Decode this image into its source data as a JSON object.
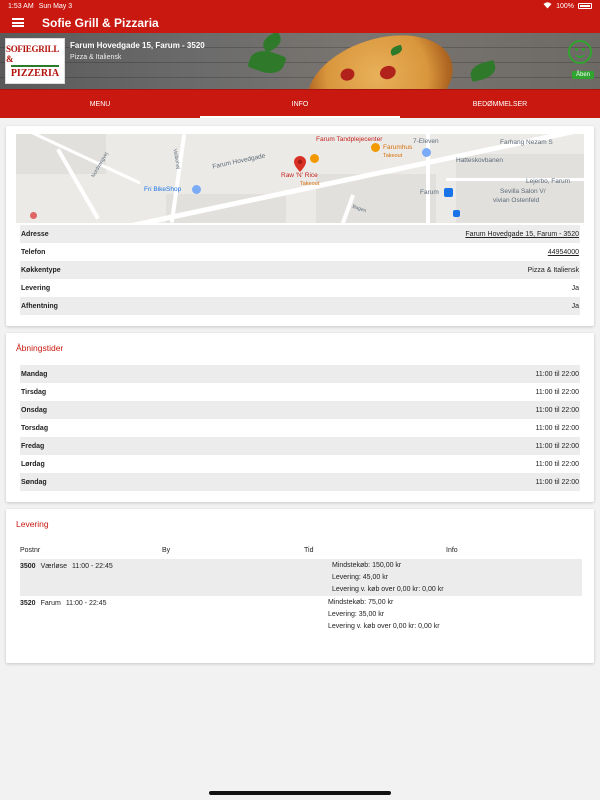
{
  "status_bar": {
    "time": "1:53 AM",
    "date": "Sun May 3",
    "battery": "100%"
  },
  "app_bar": {
    "title": "Sofie Grill & Pizzaria"
  },
  "hero": {
    "logo_line1": "SOFIEGRILL &",
    "logo_line2": "PIZZERIA",
    "address": "Farum Hovedgade 15, Farum - 3520",
    "cuisine": "Pizza & Italiensk",
    "status_badge": "Åben"
  },
  "tabs": [
    {
      "label": "MENU"
    },
    {
      "label": "INFO",
      "active": true
    },
    {
      "label": "BEDØMMELSER"
    }
  ],
  "map": {
    "labels": {
      "tandpleje": "Farum Tandplejecenter",
      "farumhus": "Farumhus",
      "farumhus_sub": "Takeout",
      "raw": "Raw 'N' Rice",
      "raw_sub": "Takeout",
      "eleven": "7-Eleven",
      "farhang": "Farhang Nezam S",
      "hovedgade": "Farum Hovedgade",
      "bikeshop": "Fri BikeShop",
      "hatesko": "Hatteskovbanen",
      "lejerbo": "Lejerbo, Farum",
      "farum": "Farum",
      "sevilla1": "Sevilla Salon V/",
      "sevilla2": "vivian Ostenfeld",
      "nordvej": "Nordvangvej",
      "valby": "Vallbohøj",
      "bagen": "Bagen"
    }
  },
  "info": {
    "rows": [
      {
        "key": "Adresse",
        "value": "Farum Hovedgade 15, Farum - 3520",
        "link": true
      },
      {
        "key": "Telefon",
        "value": "44954000",
        "link": true
      },
      {
        "key": "Køkkentype",
        "value": "Pizza & Italiensk",
        "link": false
      },
      {
        "key": "Levering",
        "value": "Ja",
        "link": false
      },
      {
        "key": "Afhentning",
        "value": "Ja",
        "link": false
      }
    ]
  },
  "hours": {
    "title": "Åbningstider",
    "rows": [
      {
        "day": "Mandag",
        "time": "11:00 til 22:00"
      },
      {
        "day": "Tirsdag",
        "time": "11:00 til 22:00"
      },
      {
        "day": "Onsdag",
        "time": "11:00 til 22:00"
      },
      {
        "day": "Torsdag",
        "time": "11:00 til 22:00"
      },
      {
        "day": "Fredag",
        "time": "11:00 til 22:00"
      },
      {
        "day": "Lørdag",
        "time": "11:00 til 22:00"
      },
      {
        "day": "Søndag",
        "time": "11:00 til 22:00"
      }
    ]
  },
  "delivery": {
    "title": "Levering",
    "columns": [
      "Postnr",
      "By",
      "Tid",
      "Info"
    ],
    "rows": [
      {
        "postnr": "3500",
        "by": "Værløse",
        "tid": "11:00 - 22:45",
        "info": [
          "Mindstekøb: 150,00 kr",
          "Levering: 45,00 kr",
          "Levering v. køb over 0,00 kr: 0,00 kr"
        ]
      },
      {
        "postnr": "3520",
        "by": "Farum",
        "tid": "11:00 - 22:45",
        "info": [
          "Mindstekøb: 75,00 kr",
          "Levering: 35,00 kr",
          "Levering v. køb over 0,00 kr: 0,00 kr"
        ]
      }
    ]
  },
  "colors": {
    "brand_red": "#c8180f",
    "open_green": "#2fa52f"
  }
}
